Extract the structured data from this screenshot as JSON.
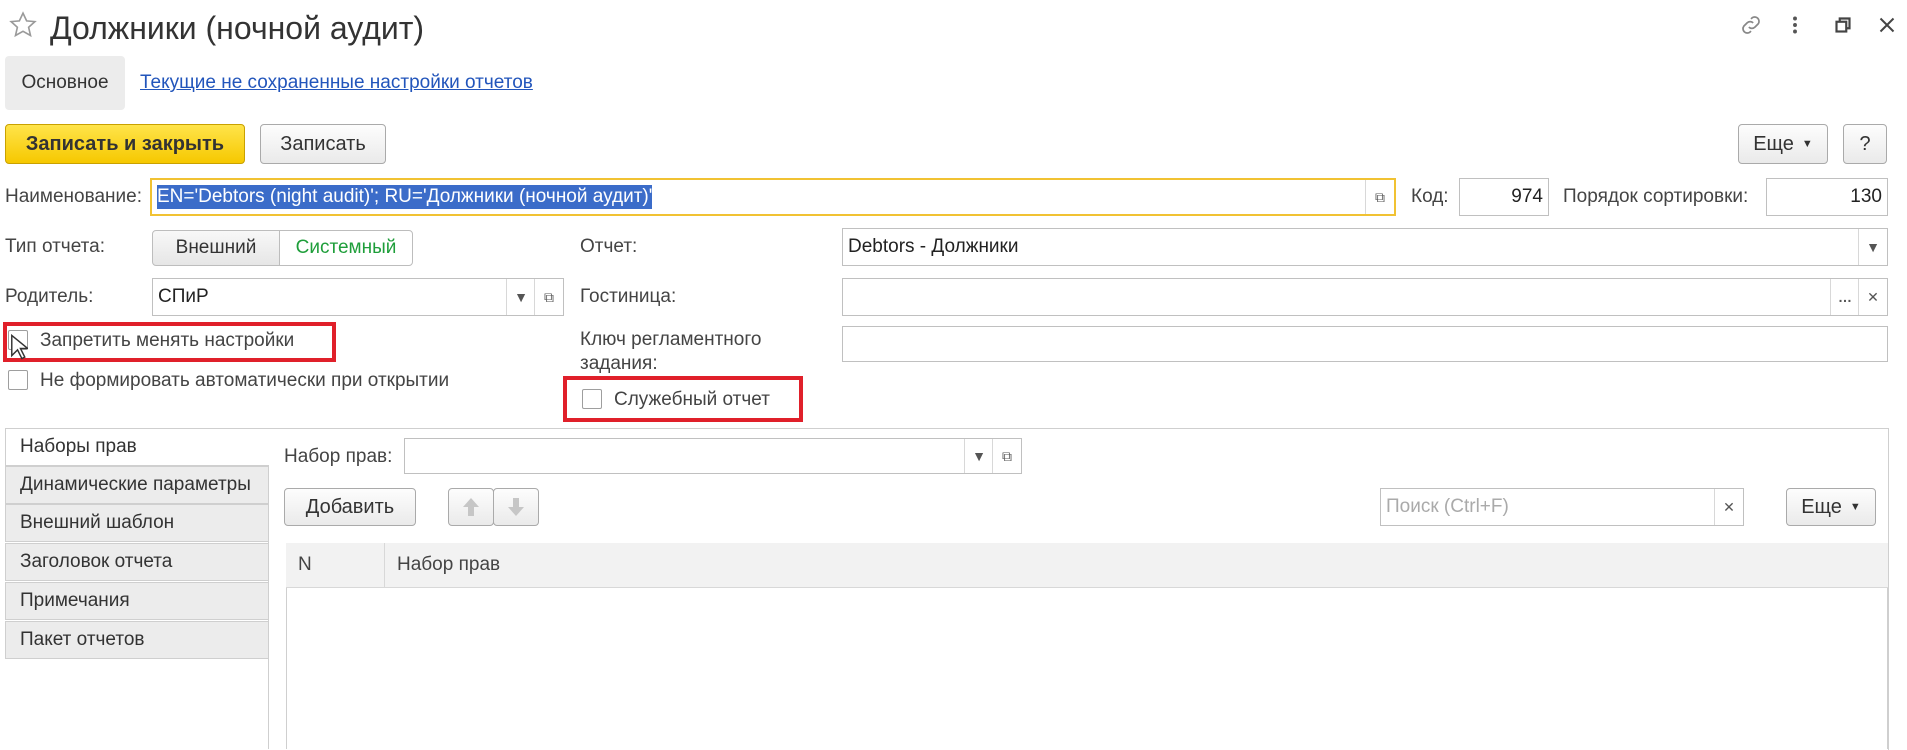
{
  "window": {
    "title": "Должники (ночной аудит)",
    "icons": [
      "star-icon",
      "link-icon",
      "more-vertical-icon",
      "restore-window-icon",
      "close-icon"
    ]
  },
  "top_tabs": {
    "main": "Основное",
    "link": "Текущие не сохраненные настройки отчетов"
  },
  "toolbar": {
    "save_close": "Записать и закрыть",
    "save": "Записать",
    "more": "Еще",
    "help": "?"
  },
  "form": {
    "name_label": "Наименование:",
    "name_value": "EN='Debtors (night audit)'; RU='Должники (ночной аудит)'",
    "code_label": "Код:",
    "code_value": "974",
    "sort_label": "Порядок сортировки:",
    "sort_value": "130",
    "type_label": "Тип отчета:",
    "type_external": "Внешний",
    "type_system": "Системный",
    "report_label": "Отчет:",
    "report_value": "Debtors - Должники",
    "parent_label": "Родитель:",
    "parent_value": "СПиР",
    "hotel_label": "Гостиница:",
    "hotel_value": "",
    "key_label_1": "Ключ регламентного",
    "key_label_2": "задания:",
    "key_value": "",
    "forbid_settings": "Запретить менять настройки",
    "no_auto_form": "Не формировать автоматически при открытии",
    "service_report": "Служебный отчет"
  },
  "side_tabs": [
    "Наборы прав",
    "Динамические параметры",
    "Внешний шаблон",
    "Заголовок отчета",
    "Примечания",
    "Пакет отчетов"
  ],
  "rights": {
    "set_label": "Набор прав:",
    "set_value": "",
    "add": "Добавить",
    "search_placeholder": "Поиск (Ctrl+F)",
    "more": "Еще",
    "columns": [
      "N",
      "Набор прав"
    ]
  },
  "colors": {
    "accent_yellow": "#f6c800",
    "link": "#2255bb",
    "highlight_red": "#e0202a",
    "system_green": "#1e9e3a",
    "selection": "#3b6cc9"
  }
}
